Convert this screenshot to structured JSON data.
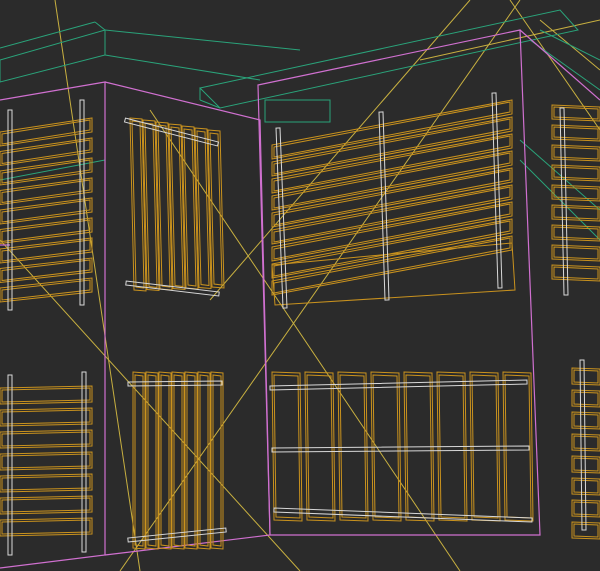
{
  "viewport": {
    "background": "#2b2b2b",
    "colors": {
      "building_outline": "#d070d0",
      "beam": "#2aa37a",
      "wood_slat": "#c9921e",
      "wood_slat_light": "#d4a022",
      "metal_rail": "#d8d8d8",
      "guide_line": "#c8b040",
      "guide_line_faint": "#a89030"
    }
  }
}
